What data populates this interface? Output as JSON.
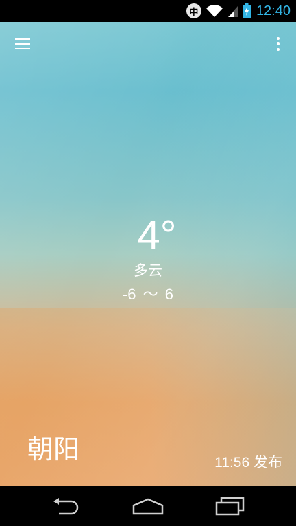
{
  "status_bar": {
    "ime_label": "中",
    "wifi_icon": "wifi-icon",
    "signal_icon": "signal-icon",
    "battery_icon": "battery-charging-icon",
    "time": "12:40"
  },
  "toolbar": {
    "menu_icon": "menu-icon",
    "overflow_icon": "more-vert-icon"
  },
  "weather": {
    "temperature": "4°",
    "condition": "多云",
    "range": "-6 ～ 6",
    "city": "朝阳",
    "publish_time": "11:56 发布"
  },
  "nav_bar": {
    "back_icon": "back-icon",
    "home_icon": "home-icon",
    "recents_icon": "recents-icon"
  },
  "colors": {
    "accent": "#33b5e5",
    "sky_top": "#6bbfcf",
    "sky_bottom": "#e6a56a"
  }
}
